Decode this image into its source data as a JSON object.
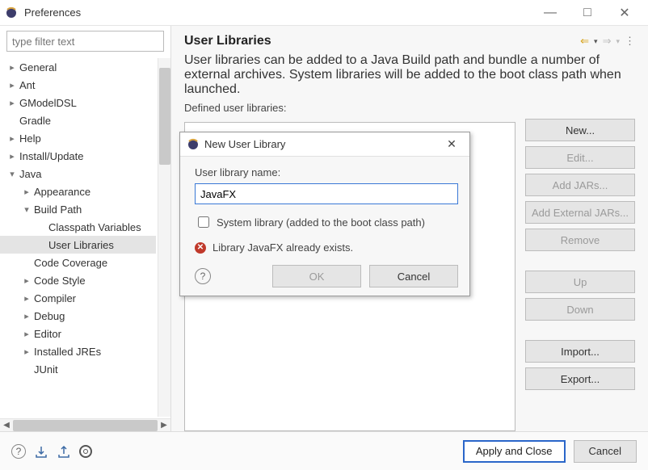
{
  "window": {
    "title": "Preferences"
  },
  "sidebar": {
    "filter_placeholder": "type filter text",
    "items": [
      {
        "label": "General",
        "depth": 0,
        "exp": "collapsed"
      },
      {
        "label": "Ant",
        "depth": 0,
        "exp": "collapsed"
      },
      {
        "label": "GModelDSL",
        "depth": 0,
        "exp": "collapsed"
      },
      {
        "label": "Gradle",
        "depth": 0,
        "exp": "none"
      },
      {
        "label": "Help",
        "depth": 0,
        "exp": "collapsed"
      },
      {
        "label": "Install/Update",
        "depth": 0,
        "exp": "collapsed"
      },
      {
        "label": "Java",
        "depth": 0,
        "exp": "expanded"
      },
      {
        "label": "Appearance",
        "depth": 1,
        "exp": "collapsed"
      },
      {
        "label": "Build Path",
        "depth": 1,
        "exp": "expanded"
      },
      {
        "label": "Classpath Variables",
        "depth": 2,
        "exp": "none"
      },
      {
        "label": "User Libraries",
        "depth": 2,
        "exp": "none",
        "selected": true
      },
      {
        "label": "Code Coverage",
        "depth": 1,
        "exp": "none"
      },
      {
        "label": "Code Style",
        "depth": 1,
        "exp": "collapsed"
      },
      {
        "label": "Compiler",
        "depth": 1,
        "exp": "collapsed"
      },
      {
        "label": "Debug",
        "depth": 1,
        "exp": "collapsed"
      },
      {
        "label": "Editor",
        "depth": 1,
        "exp": "collapsed"
      },
      {
        "label": "Installed JREs",
        "depth": 1,
        "exp": "collapsed"
      },
      {
        "label": "JUnit",
        "depth": 1,
        "exp": "none"
      }
    ]
  },
  "right": {
    "title": "User Libraries",
    "description": "User libraries can be added to a Java Build path and bundle a number of external archives. System libraries will be added to the boot class path when launched.",
    "defined_label": "Defined user libraries:",
    "buttons": {
      "new": "New...",
      "edit": "Edit...",
      "add_jars": "Add JARs...",
      "add_ext_jars": "Add External JARs...",
      "remove": "Remove",
      "up": "Up",
      "down": "Down",
      "import": "Import...",
      "export": "Export..."
    }
  },
  "footer": {
    "apply": "Apply and Close",
    "cancel": "Cancel"
  },
  "modal": {
    "title": "New User Library",
    "name_label": "User library name:",
    "name_value": "JavaFX",
    "checkbox_label": "System library (added to the boot class path)",
    "error": "Library JavaFX already exists.",
    "ok": "OK",
    "cancel": "Cancel"
  }
}
